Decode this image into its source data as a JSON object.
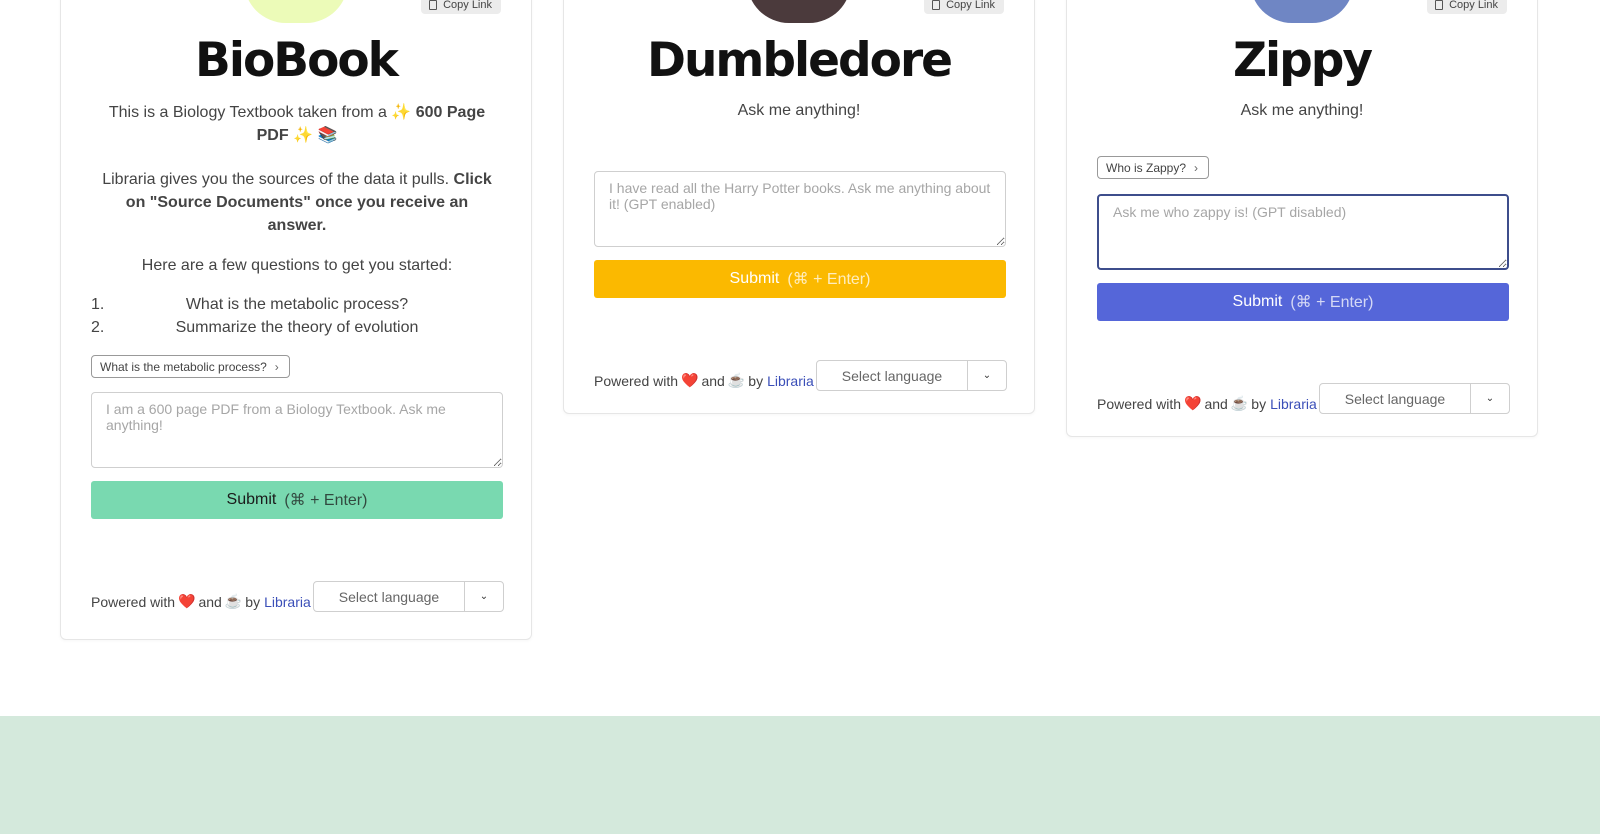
{
  "colors": {
    "biobook_submit": "#79d9b0",
    "dumbledore_submit": "#fbb900",
    "zippy_submit": "#5566d9",
    "bottom_band": "#d4e9dc",
    "link": "#3b4fb8"
  },
  "common": {
    "copy_link": "Copy Link",
    "submit_label": "Submit",
    "submit_hint": "(⌘ + Enter)",
    "powered_with": "Powered with",
    "and": "and",
    "by": "by",
    "brand_link": "Libraria",
    "heart": "❤️",
    "coffee": "☕",
    "language_placeholder": "Select language",
    "icons": {
      "copy": "document-icon",
      "caret": "chevron-down-icon",
      "chip": "chevron-right-icon"
    }
  },
  "biobook": {
    "title": "BioBook",
    "description_1_pre": "This is a Biology Textbook taken from a ✨ ",
    "description_1_bold": "600 Page PDF",
    "description_1_post": " ✨ 📚",
    "description_2_pre": "Libraria gives you the sources of the data it pulls. ",
    "description_2_bold": "Click on \"Source Documents\" once you receive an answer.",
    "questions_intro": "Here are a few questions to get you started:",
    "questions": [
      {
        "num": "1.",
        "text": "What is the metabolic process?"
      },
      {
        "num": "2.",
        "text": "Summarize the theory of evolution"
      }
    ],
    "chip": "What is the metabolic process?",
    "placeholder": "I am a 600 page PDF from a Biology Textbook. Ask me anything!"
  },
  "dumbledore": {
    "title": "Dumbledore",
    "subtitle": "Ask me anything!",
    "placeholder": "I have read all the Harry Potter books. Ask me anything about it! (GPT enabled)"
  },
  "zippy": {
    "title": "Zippy",
    "subtitle": "Ask me anything!",
    "chip": "Who is Zappy?",
    "placeholder": "Ask me who zappy is! (GPT disabled)"
  }
}
